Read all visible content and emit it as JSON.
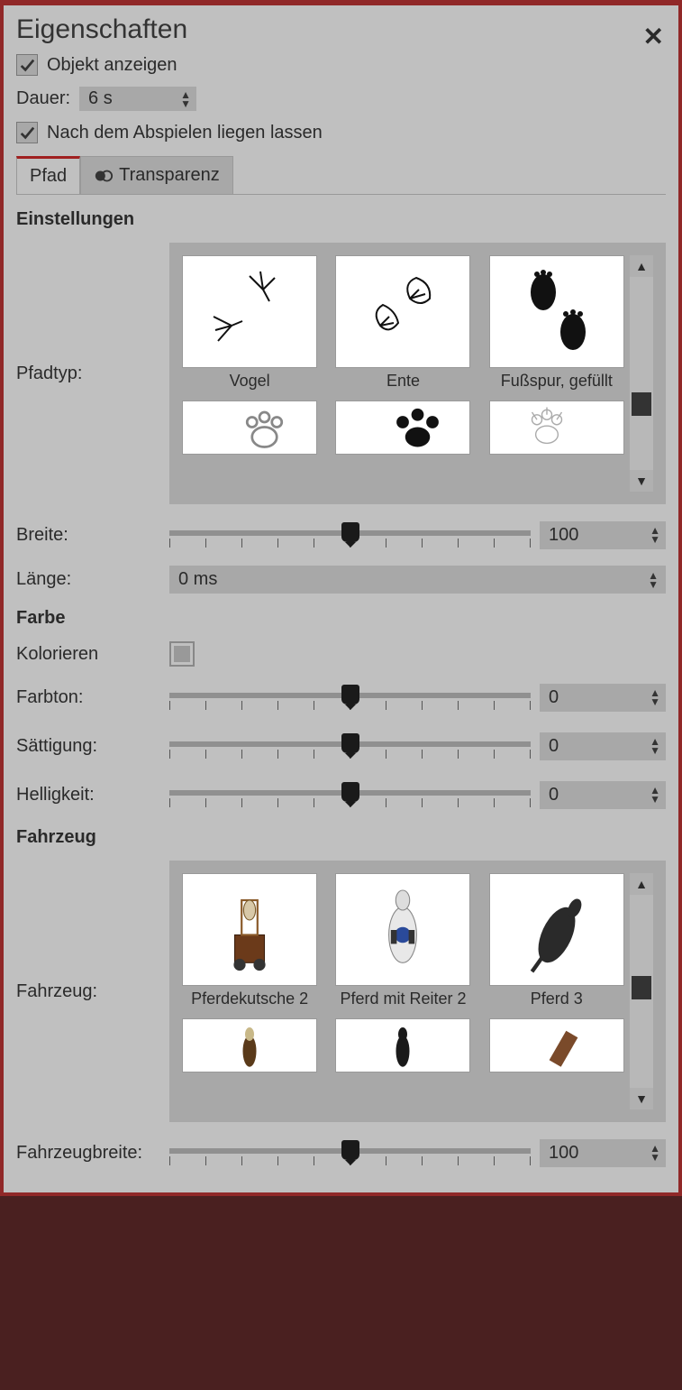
{
  "title": "Eigenschaften",
  "show_object_label": "Objekt anzeigen",
  "show_object_checked": true,
  "duration_label": "Dauer:",
  "duration_value": "6 s",
  "leave_after_label": "Nach dem Abspielen liegen lassen",
  "leave_after_checked": true,
  "tabs": [
    {
      "label": "Pfad",
      "active": true
    },
    {
      "label": "Transparenz",
      "active": false
    }
  ],
  "settings_heading": "Einstellungen",
  "path_type_label": "Pfadtyp:",
  "path_types_row1": [
    {
      "label": "Vogel"
    },
    {
      "label": "Ente"
    },
    {
      "label": "Fußspur, gefüllt"
    }
  ],
  "width_label": "Breite:",
  "width_value": "100",
  "length_label": "Länge:",
  "length_value": "0 ms",
  "color_heading": "Farbe",
  "colorize_label": "Kolorieren",
  "hue_label": "Farbton:",
  "hue_value": "0",
  "saturation_label": "Sättigung:",
  "saturation_value": "0",
  "brightness_label": "Helligkeit:",
  "brightness_value": "0",
  "vehicle_heading": "Fahrzeug",
  "vehicle_label": "Fahrzeug:",
  "vehicles_row1": [
    {
      "label": "Pferdekutsche 2"
    },
    {
      "label": "Pferd mit Reiter 2"
    },
    {
      "label": "Pferd 3"
    }
  ],
  "vehicle_width_label": "Fahrzeugbreite:",
  "vehicle_width_value": "100"
}
